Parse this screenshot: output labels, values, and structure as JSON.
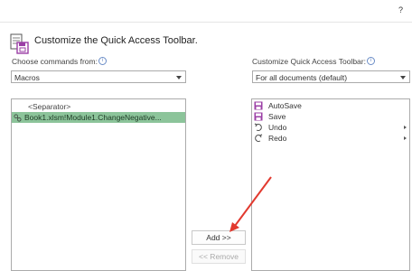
{
  "header": {
    "help_label": "?"
  },
  "title": {
    "text": "Customize the Quick Access Toolbar."
  },
  "left": {
    "label": "Choose commands from:",
    "label_info": "i",
    "dropdown_value": "Macros",
    "items": [
      {
        "label": "<Separator>",
        "type": "separator"
      },
      {
        "label": "Book1.xlsm!Module1.ChangeNegative...",
        "type": "macro",
        "selected": true
      }
    ]
  },
  "right": {
    "label": "Customize Quick Access Toolbar:",
    "label_info": "i",
    "dropdown_value": "For all documents (default)",
    "items": [
      {
        "label": "AutoSave",
        "icon": "autosave-icon"
      },
      {
        "label": "Save",
        "icon": "save-icon"
      },
      {
        "label": "Undo",
        "icon": "undo-icon",
        "has_submenu": true
      },
      {
        "label": "Redo",
        "icon": "redo-icon",
        "has_submenu": true
      }
    ]
  },
  "buttons": {
    "add": "Add >>",
    "remove": "<< Remove"
  },
  "colors": {
    "selection": "#8cc49a",
    "icon_purple": "#9b3fa6",
    "arrow_red": "#e23a2f"
  }
}
